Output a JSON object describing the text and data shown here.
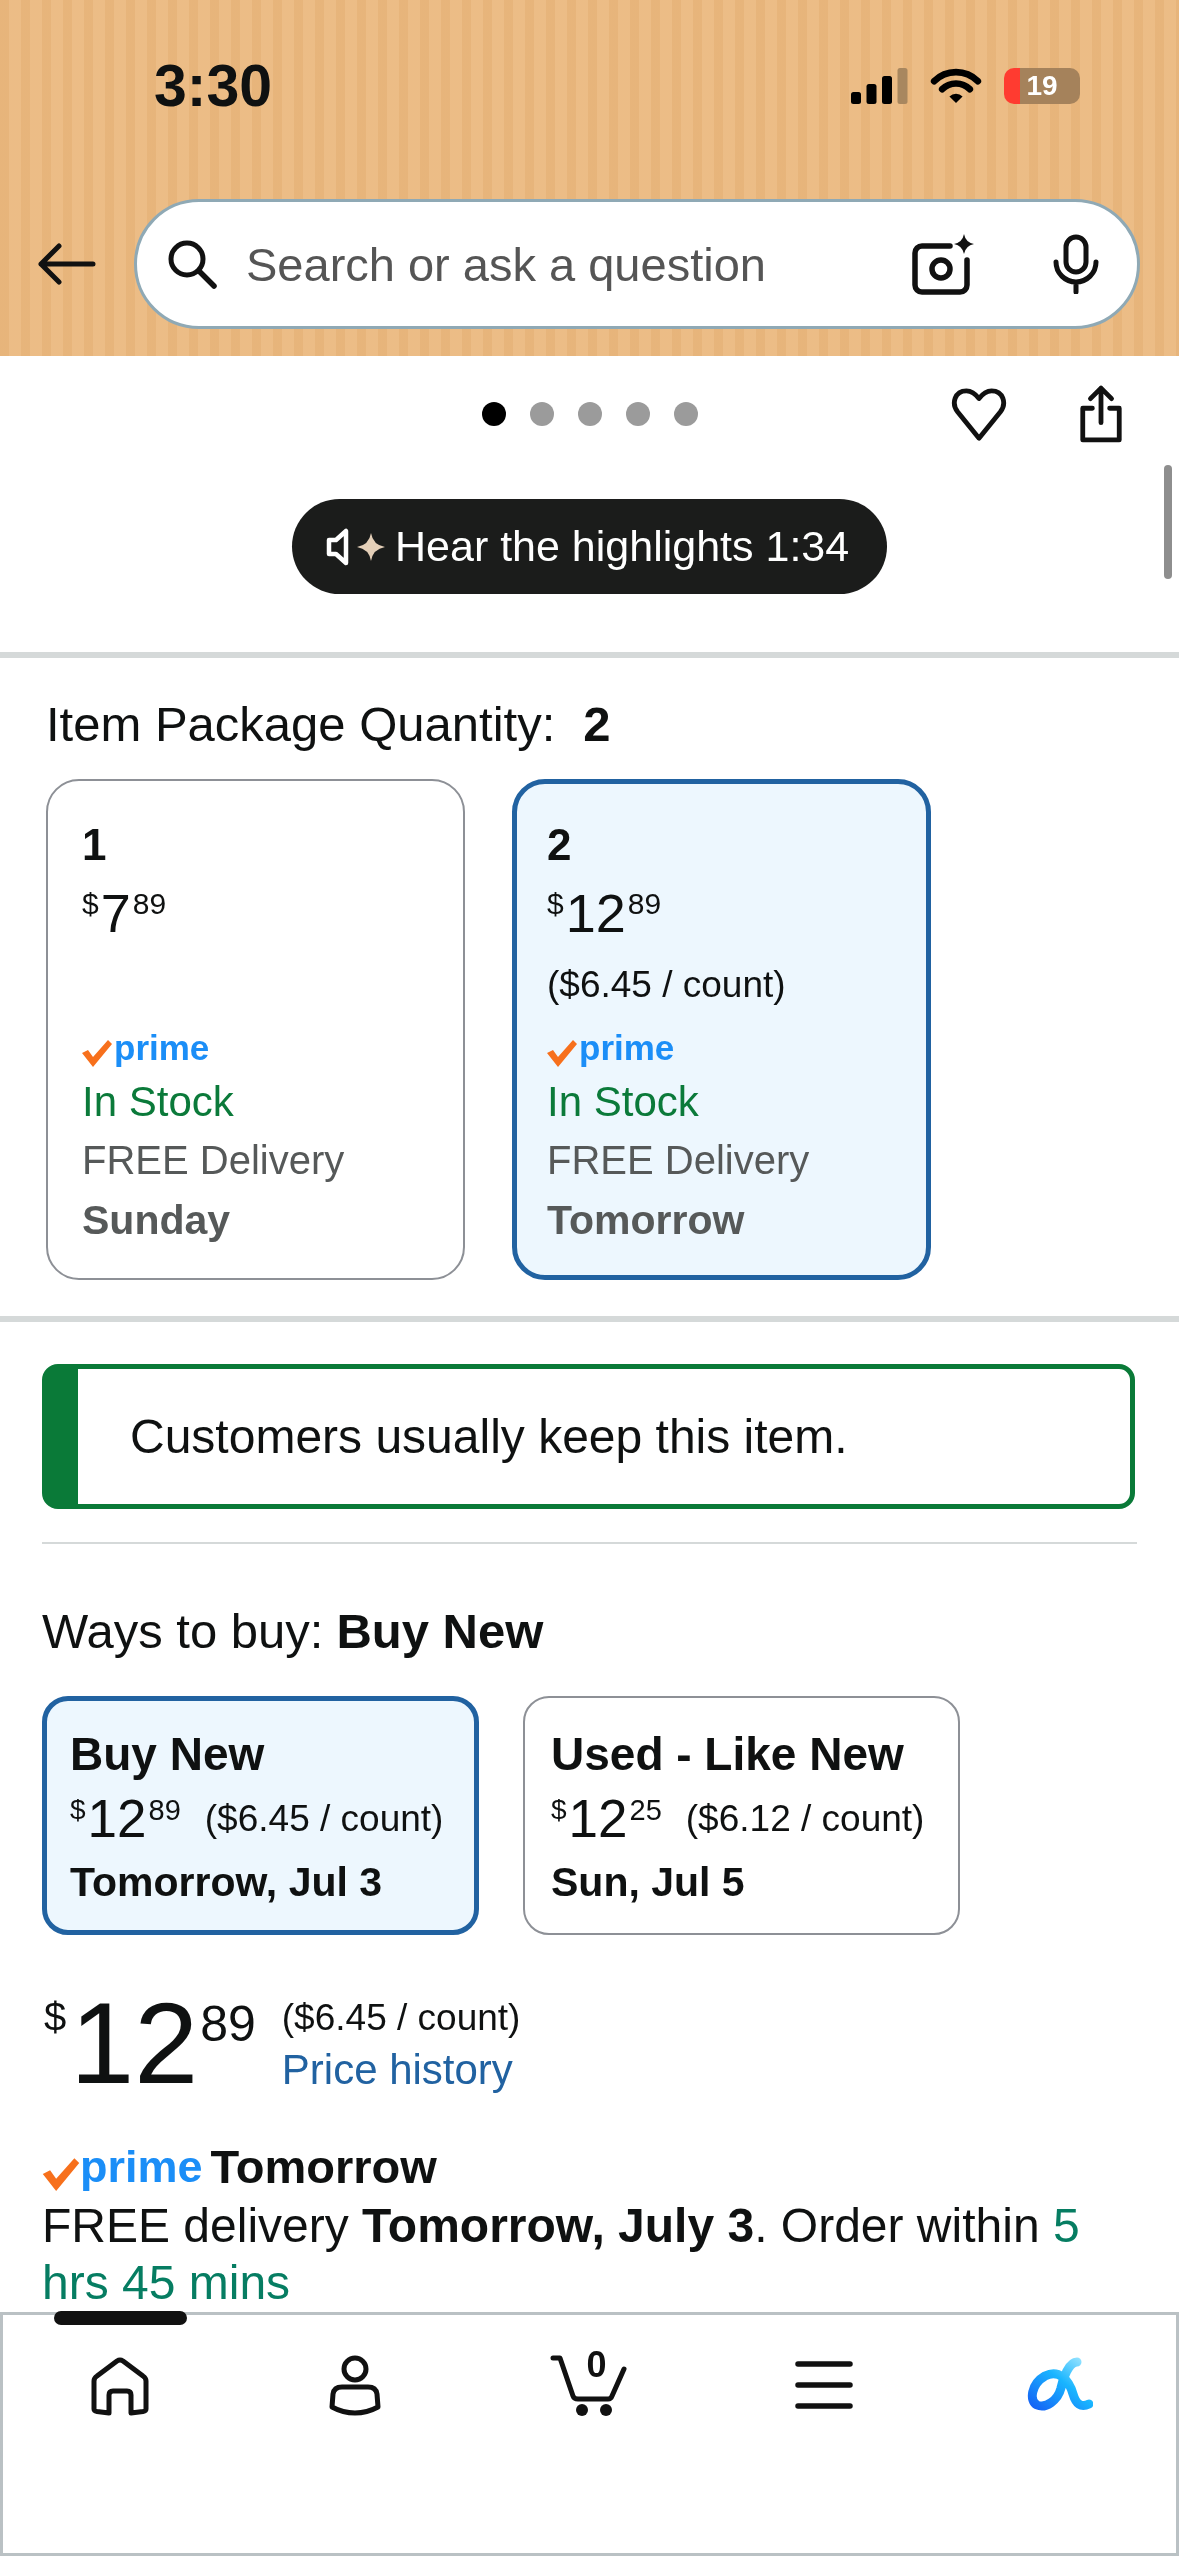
{
  "status_bar": {
    "time": "3:30",
    "battery": "19"
  },
  "search": {
    "placeholder": "Search or ask a question"
  },
  "carousel": {
    "dots": [
      {
        "selected": true
      },
      {
        "selected": false
      },
      {
        "selected": false
      },
      {
        "selected": false
      },
      {
        "selected": false
      }
    ]
  },
  "audio_button": {
    "label": "Hear the highlights 1:34"
  },
  "package_quantity": {
    "label": "Item Package Quantity:",
    "value": "2",
    "options": [
      {
        "quantity": "1",
        "currency": "$",
        "whole": "7",
        "fraction": "89",
        "badge": "prime",
        "stock": "In Stock",
        "delivery": "FREE Delivery",
        "delivery_day": "Sunday",
        "selected": false
      },
      {
        "quantity": "2",
        "currency": "$",
        "whole": "12",
        "fraction": "89",
        "unit_price": "($6.45 / count)",
        "badge": "prime",
        "stock": "In Stock",
        "delivery": "FREE Delivery",
        "delivery_day": "Tomorrow",
        "selected": true
      }
    ]
  },
  "return_notice": {
    "text": "Customers usually keep this item."
  },
  "ways_to_buy": {
    "label": "Ways to buy:",
    "value": "Buy New",
    "options": [
      {
        "title": "Buy New",
        "currency": "$",
        "whole": "12",
        "fraction": "89",
        "unit_price": "($6.45 / count)",
        "delivery": "Tomorrow, Jul 3",
        "selected": true
      },
      {
        "title": "Used - Like New",
        "currency": "$",
        "whole": "12",
        "fraction": "25",
        "unit_price": "($6.12 / count)",
        "delivery": "Sun, Jul 5",
        "selected": false
      }
    ]
  },
  "price": {
    "currency": "$",
    "whole": "12",
    "fraction": "89",
    "unit_price": "($6.45 / count)",
    "history_link": "Price history"
  },
  "delivery": {
    "badge": "prime",
    "speed": "Tomorrow",
    "message": "FREE delivery **Tomorrow, July 3**. Order within",
    "countdown": "5 hrs 45 mins"
  },
  "bottom_nav": {
    "items": [
      {
        "kind": "home",
        "selected": true
      },
      {
        "kind": "account",
        "selected": false
      },
      {
        "kind": "cart",
        "count": "0",
        "selected": false
      },
      {
        "kind": "menu",
        "selected": false
      },
      {
        "kind": "assistant",
        "selected": false
      }
    ]
  }
}
